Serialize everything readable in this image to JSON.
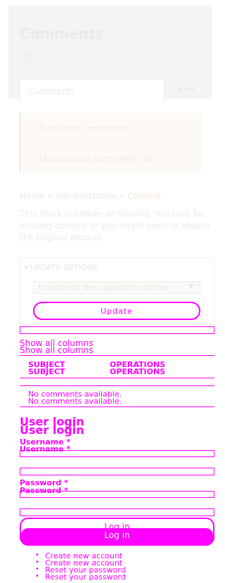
{
  "header": {
    "title": "Comments",
    "tabs": {
      "active": "Comments",
      "more": "•••"
    }
  },
  "subtabs": {
    "published": "Published comments",
    "unapproved": "Unapproved comments (0)"
  },
  "breadcrumb": "Home » Administration » Content",
  "broken_block_message": "This block is broken or missing. You may be missing content or you might need to enable the original module.",
  "update_options": {
    "legend": "▾ UPDATE OPTIONS",
    "select_value": "Unpublish the selected comme",
    "button": "Update"
  },
  "table": {
    "show_all_columns": "Show all columns",
    "headers": {
      "subject": "SUBJECT",
      "operations": "OPERATIONS"
    },
    "empty": "No comments available."
  },
  "login": {
    "title": "User login",
    "username_label": "Username",
    "password_label": "Password",
    "required_mark": "*",
    "button": "Log in",
    "links": [
      "Create new account",
      "Reset your password"
    ]
  },
  "colors": {
    "accent": "#ff00ff",
    "ghost": "#ece8e4"
  },
  "icons": {
    "favorite": "star-outline-icon",
    "dropdown": "triangle-down-icon"
  }
}
